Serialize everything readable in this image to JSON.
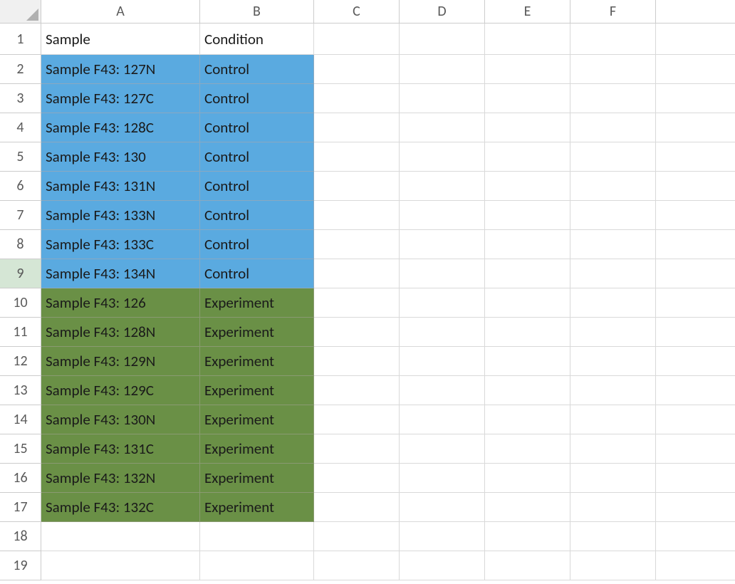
{
  "columns": [
    "A",
    "B",
    "C",
    "D",
    "E",
    "F"
  ],
  "row_count": 19,
  "active_row_header": 9,
  "header_row": {
    "A": "Sample",
    "B": "Condition"
  },
  "data_rows": [
    {
      "row": 2,
      "A": "Sample F43: 127N",
      "B": "Control",
      "fill": "blue"
    },
    {
      "row": 3,
      "A": "Sample F43: 127C",
      "B": "Control",
      "fill": "blue"
    },
    {
      "row": 4,
      "A": "Sample F43: 128C",
      "B": "Control",
      "fill": "blue"
    },
    {
      "row": 5,
      "A": "Sample F43: 130",
      "B": "Control",
      "fill": "blue"
    },
    {
      "row": 6,
      "A": "Sample F43: 131N",
      "B": "Control",
      "fill": "blue"
    },
    {
      "row": 7,
      "A": "Sample F43: 133N",
      "B": "Control",
      "fill": "blue"
    },
    {
      "row": 8,
      "A": "Sample F43: 133C",
      "B": "Control",
      "fill": "blue"
    },
    {
      "row": 9,
      "A": "Sample F43: 134N",
      "B": "Control",
      "fill": "blue"
    },
    {
      "row": 10,
      "A": "Sample F43: 126",
      "B": "Experiment",
      "fill": "green"
    },
    {
      "row": 11,
      "A": "Sample F43: 128N",
      "B": "Experiment",
      "fill": "green"
    },
    {
      "row": 12,
      "A": "Sample F43: 129N",
      "B": "Experiment",
      "fill": "green"
    },
    {
      "row": 13,
      "A": "Sample F43: 129C",
      "B": "Experiment",
      "fill": "green"
    },
    {
      "row": 14,
      "A": "Sample F43: 130N",
      "B": "Experiment",
      "fill": "green"
    },
    {
      "row": 15,
      "A": "Sample F43: 131C",
      "B": "Experiment",
      "fill": "green"
    },
    {
      "row": 16,
      "A": "Sample F43: 132N",
      "B": "Experiment",
      "fill": "green"
    },
    {
      "row": 17,
      "A": "Sample F43: 132C",
      "B": "Experiment",
      "fill": "green"
    }
  ],
  "colors": {
    "blue_fill": "#5aaae0",
    "green_fill": "#6a9046"
  }
}
